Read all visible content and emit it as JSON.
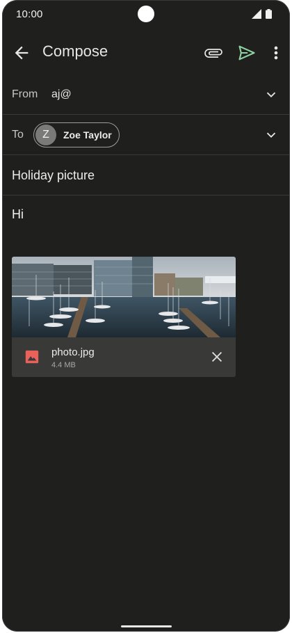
{
  "status_bar": {
    "time": "10:00"
  },
  "app_bar": {
    "title": "Compose",
    "icons": [
      "back-arrow-icon",
      "paperclip-icon",
      "send-icon",
      "more-vert-icon"
    ],
    "send_color": "#8fd3a2"
  },
  "from": {
    "label": "From",
    "value": "aj@"
  },
  "to": {
    "label": "To",
    "recipient": {
      "initial": "Z",
      "name": "Zoe Taylor"
    }
  },
  "subject": "Holiday picture",
  "body": "Hi",
  "attachment": {
    "file_name": "photo.jpg",
    "file_size": "4.4 MB",
    "icon": "image-file-icon",
    "icon_color": "#e8625b"
  }
}
